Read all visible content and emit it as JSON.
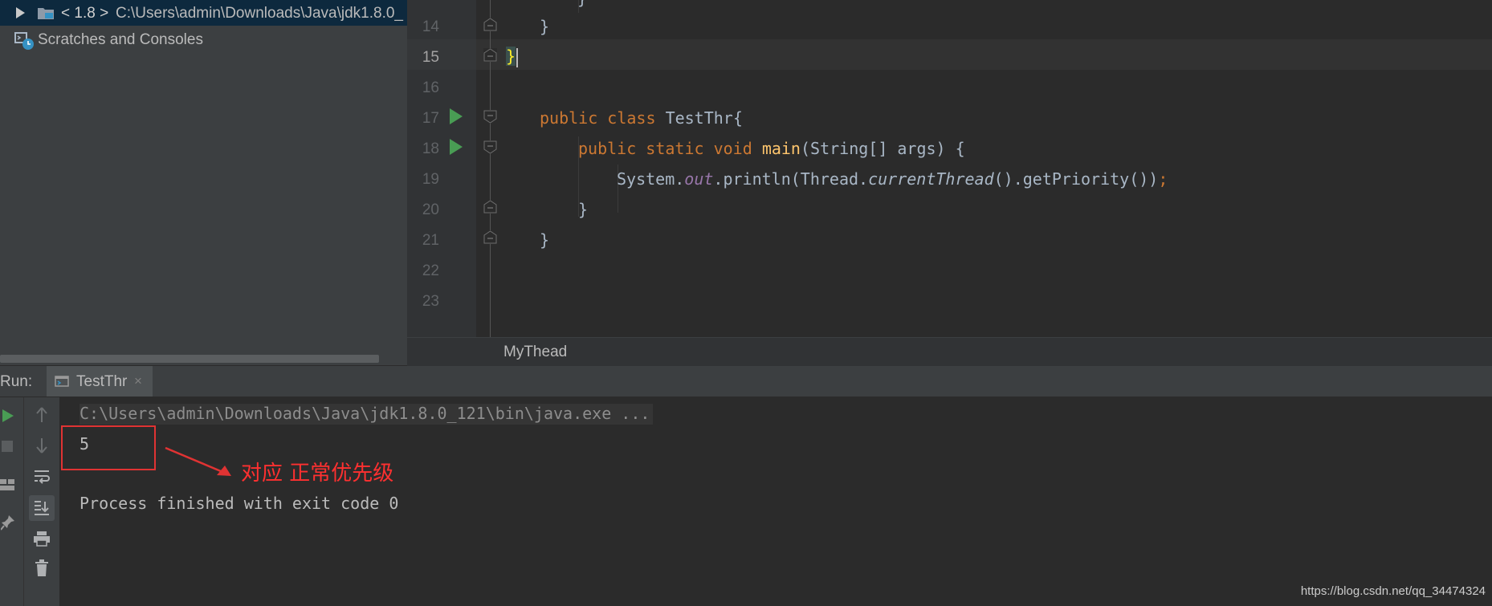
{
  "project_tree": {
    "jdk_item": {
      "label": "< 1.8 >",
      "path": "C:\\Users\\admin\\Downloads\\Java\\jdk1.8.0_"
    },
    "scratches_item": {
      "label": "Scratches and Consoles"
    }
  },
  "editor": {
    "line_numbers": [
      "14",
      "15",
      "16",
      "17",
      "18",
      "19",
      "20",
      "21",
      "22",
      "23"
    ],
    "current_line": "15",
    "code": {
      "line14": "}",
      "line15": "}",
      "line17_kw1": "public",
      "line17_kw2": "class",
      "line17_name": "TestThr{",
      "line18_kw1": "public",
      "line18_kw2": "static",
      "line18_kw3": "void",
      "line18_fn": "main",
      "line18_rest": "(String[] args) {",
      "line19_a": "System.",
      "line19_out": "out",
      "line19_b": ".println(Thread.",
      "line19_ct": "currentThread",
      "line19_c": "().getPriority())",
      "line19_semi": ";",
      "line20": "}",
      "line21": "}"
    },
    "breadcrumb": "MyThead"
  },
  "run_panel": {
    "title": "Run:",
    "tab_label": "TestThr",
    "tab_close": "×",
    "console": {
      "command": "C:\\Users\\admin\\Downloads\\Java\\jdk1.8.0_121\\bin\\java.exe ...",
      "output": "5",
      "finish": "Process finished with exit code 0"
    }
  },
  "annotation": {
    "text": "对应 正常优先级",
    "color": "#e03333"
  },
  "watermark": "https://blog.csdn.net/qq_34474324",
  "colors": {
    "keyword": "#cc7832",
    "function": "#ffc66d",
    "field": "#9876aa",
    "run_green": "#499c54"
  }
}
